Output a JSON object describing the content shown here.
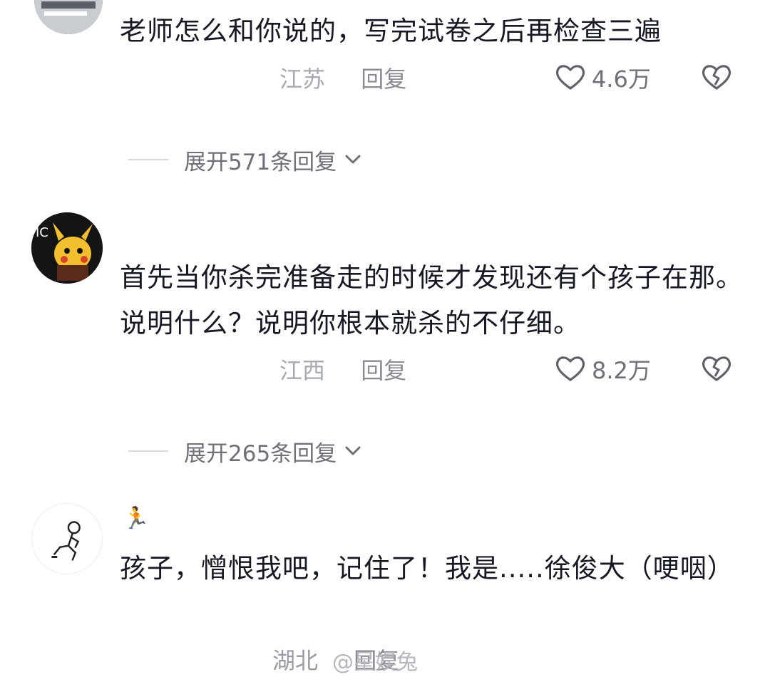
{
  "comments": [
    {
      "text": "老师怎么和你说的，写完试卷之后再检查三遍",
      "location": "江苏",
      "reply": "回复",
      "likes": "4.6万",
      "expand": "展开571条回复"
    },
    {
      "text": "首先当你杀完准备走的时候才发现还有个孩子在那。说明什么？说明你根本就杀的不仔细。",
      "location": "江西",
      "reply": "回复",
      "likes": "8.2万",
      "expand": "展开265条回复"
    },
    {
      "username_emoji": "🏃",
      "text": "孩子，憎恨我吧，记住了！我是.....徐俊大（哽咽）",
      "location": "湖北",
      "reply": "回复"
    }
  ],
  "watermark": {
    "text": "@星娱兔"
  },
  "icons": {
    "like": "heart-outline-icon",
    "dislike": "broken-heart-icon",
    "expand": "chevron-down-icon"
  }
}
